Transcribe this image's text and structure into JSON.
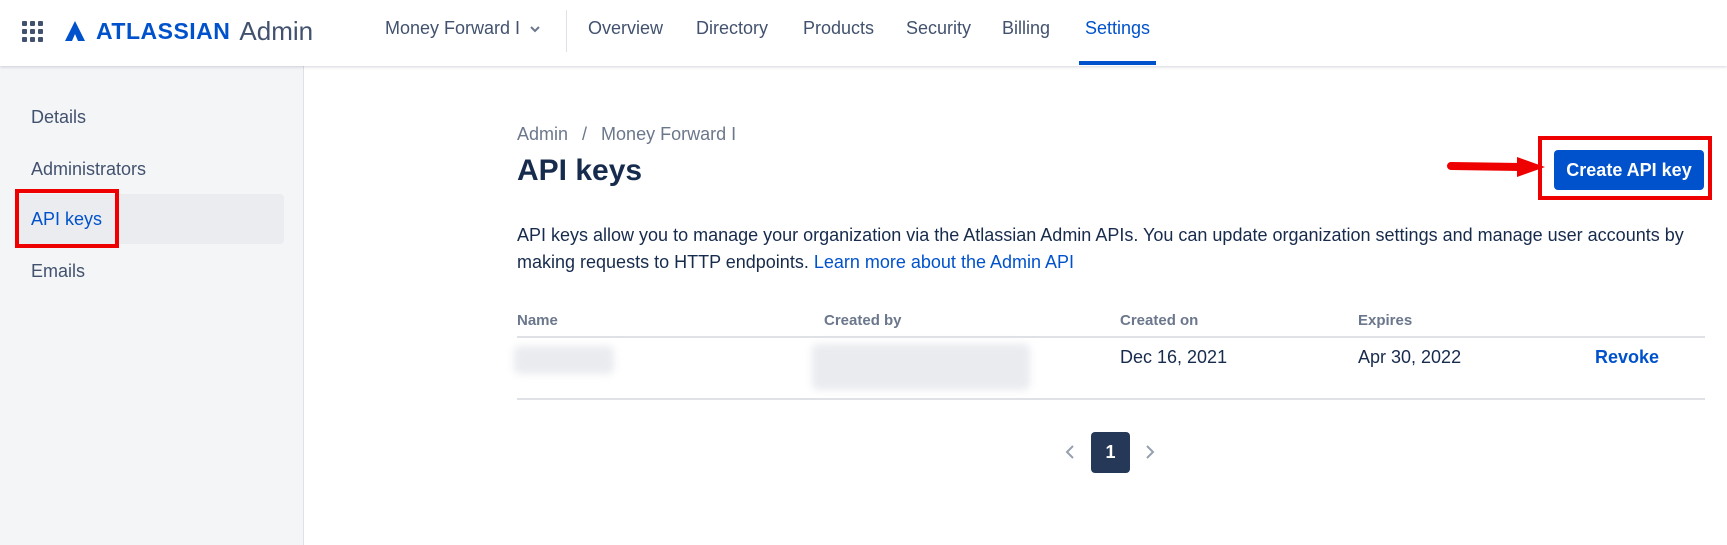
{
  "header": {
    "brand": "ATLASSIAN",
    "product": "Admin",
    "org_name": "Money Forward I",
    "tabs": [
      {
        "label": "Overview"
      },
      {
        "label": "Directory"
      },
      {
        "label": "Products"
      },
      {
        "label": "Security"
      },
      {
        "label": "Billing"
      },
      {
        "label": "Settings",
        "active": true
      }
    ]
  },
  "sidebar": {
    "items": [
      {
        "label": "Details"
      },
      {
        "label": "Administrators"
      },
      {
        "label": "API keys",
        "active": true
      },
      {
        "label": "Emails"
      }
    ]
  },
  "main": {
    "breadcrumb": [
      "Admin",
      "Money Forward I"
    ],
    "breadcrumb_separator": "/",
    "title": "API keys",
    "create_button": "Create API key",
    "description": "API keys allow you to manage your organization via the Atlassian Admin APIs. You can update organization settings and manage user accounts by making requests to HTTP endpoints.",
    "learn_more_link": "Learn more about the Admin API",
    "table": {
      "columns": [
        "Name",
        "Created by",
        "Created on",
        "Expires"
      ],
      "rows": [
        {
          "name": "",
          "created_by": "",
          "created_on": "Dec 16, 2021",
          "expires": "Apr 30, 2022",
          "action": "Revoke"
        }
      ]
    },
    "pagination": {
      "current_page": "1"
    }
  },
  "colors": {
    "brand_blue": "#0052CC",
    "annotation_red": "#EE0000",
    "sidebar_bg": "#F4F5F7",
    "text": "#172B4D"
  },
  "icons": [
    "app-switcher-icon",
    "atlassian-logo-icon",
    "chevron-down-icon",
    "chevron-left-icon",
    "chevron-right-icon",
    "red-arrow-icon"
  ]
}
